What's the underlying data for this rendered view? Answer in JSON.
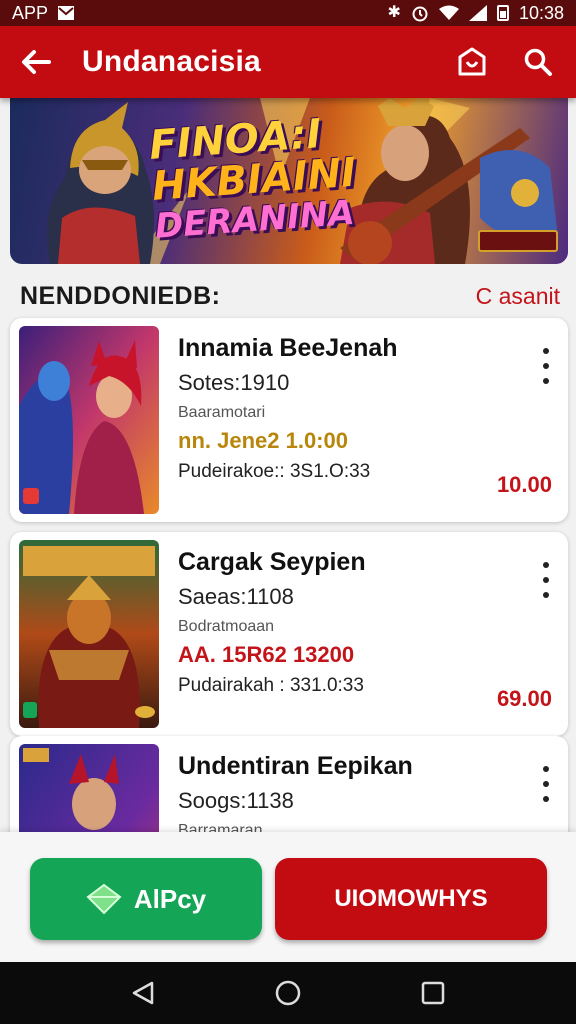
{
  "status_bar": {
    "left_label": "APP",
    "time": "10:38",
    "icons": [
      "mail-icon",
      "bluetooth-icon",
      "alarm-icon",
      "wifi-icon",
      "signal-icon",
      "battery-icon"
    ]
  },
  "app_bar": {
    "title": "Undanacisia",
    "icons": [
      "back-arrow-icon",
      "store-icon",
      "search-icon"
    ]
  },
  "banner": {
    "line1": "FINOA:I",
    "line2": "HKBIAINI",
    "line3": "DERANINA"
  },
  "section": {
    "title": "NENDDONIEDB:",
    "link": "C asanit"
  },
  "cards": [
    {
      "title": "Innamia BeeJenah",
      "subtitle": "Sotes:1910",
      "small": "Baaramotari",
      "highlight": "nn. Jene2 1.0:00",
      "highlight_color": "#b8860b",
      "meta": "Pudeirakoe:: 3S1.O:33",
      "price": "10.00"
    },
    {
      "title": "Cargak Seypien",
      "subtitle": "Saeas:1108",
      "small": "Bodratmoaan",
      "highlight": "AA. 15R62 13200",
      "highlight_color": "#c3141a",
      "meta": "Pudairakah : 331.0:33",
      "price": "69.00"
    },
    {
      "title": "Undentiran Eepikan",
      "subtitle": "Soogs:1138",
      "small": "Barramaran",
      "highlight": "",
      "highlight_color": "#c3141a",
      "meta": "",
      "price": ""
    }
  ],
  "buttons": {
    "apply": "AlPcy",
    "download": "UIOMOWHYS"
  },
  "colors": {
    "primary": "#c20c12",
    "accent_green": "#14a556",
    "price_red": "#c3141a"
  },
  "nav": [
    "back-triangle-icon",
    "home-circle-icon",
    "recents-square-icon"
  ]
}
